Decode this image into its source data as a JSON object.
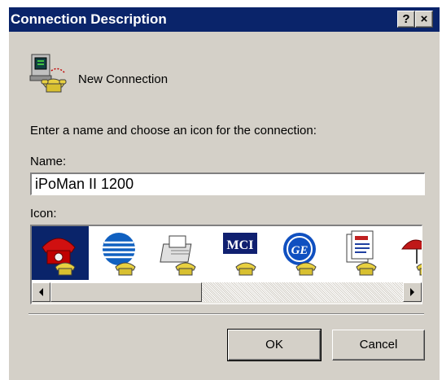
{
  "dialog": {
    "title": "Connection Description",
    "help_button": "?",
    "close_button": "×"
  },
  "connection": {
    "name_display": "New Connection",
    "icon": "phone-computer-icon"
  },
  "prompt": "Enter a name and choose an icon for the connection:",
  "name_field": {
    "label": "Name:",
    "value": "iPoMan II 1200"
  },
  "icon_field": {
    "label": "Icon:",
    "icons": [
      {
        "name": "red-phone-icon",
        "selected": true
      },
      {
        "name": "globe-phone-icon",
        "selected": false
      },
      {
        "name": "fax-phone-icon",
        "selected": false
      },
      {
        "name": "mci-phone-icon",
        "text": "MCI",
        "selected": false
      },
      {
        "name": "ge-phone-icon",
        "selected": false
      },
      {
        "name": "document-phone-icon",
        "selected": false
      },
      {
        "name": "umbrella-phone-icon",
        "selected": false
      }
    ]
  },
  "buttons": {
    "ok": "OK",
    "cancel": "Cancel"
  },
  "colors": {
    "titlebar": "#0a246a",
    "face": "#d4d0c8",
    "selection": "#0a246a"
  }
}
